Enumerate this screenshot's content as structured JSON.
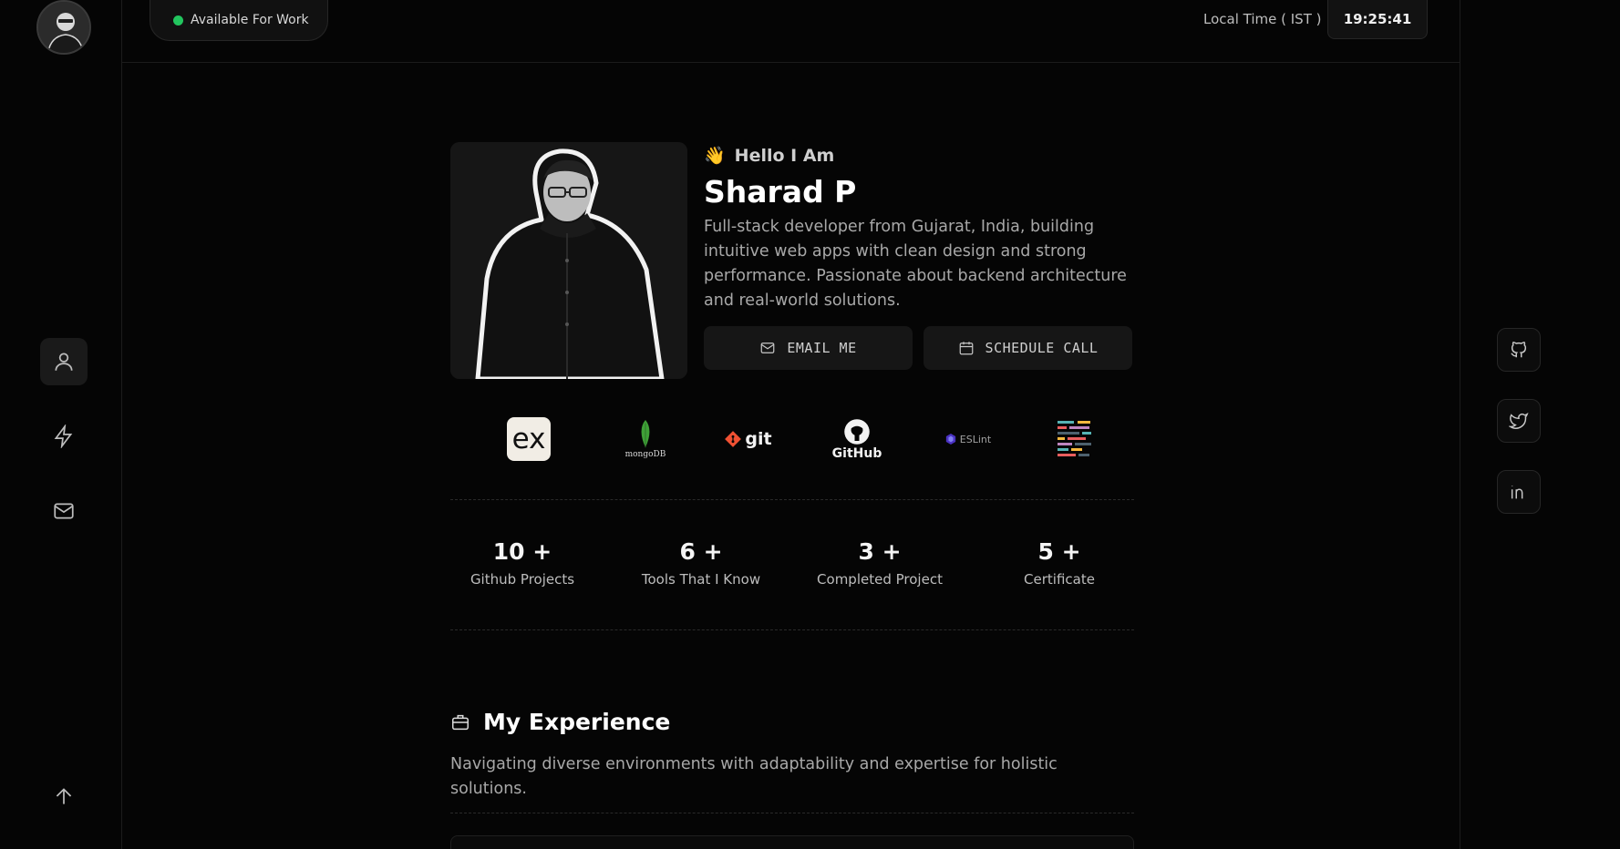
{
  "status": {
    "label": "Available For Work",
    "color": "#22c55e"
  },
  "clock": {
    "label": "Local Time ( IST )",
    "value": "19:25:41"
  },
  "sidebar": {
    "items": [
      {
        "icon": "user-icon"
      },
      {
        "icon": "lightning-icon"
      },
      {
        "icon": "mail-icon"
      }
    ],
    "scroll_top_icon": "arrow-up-icon"
  },
  "socials": [
    {
      "icon": "github-icon"
    },
    {
      "icon": "twitter-icon"
    },
    {
      "icon": "linkedin-icon"
    }
  ],
  "hero": {
    "greeting_emoji": "👋",
    "greeting": "Hello I Am",
    "name": "Sharad P",
    "bio": "Full-stack developer from Gujarat, India, building intuitive web apps with clean design and strong performance. Passionate about backend architecture and real-world solutions.",
    "email_label": "EMAIL ME",
    "schedule_label": "SCHEDULE CALL"
  },
  "tools": [
    {
      "name": "express-logo",
      "text": "ex"
    },
    {
      "name": "mongodb-logo",
      "text": "mongoDB"
    },
    {
      "name": "git-logo",
      "text": "git"
    },
    {
      "name": "github-logo",
      "text": "GitHub"
    },
    {
      "name": "eslint-logo",
      "text": "ESLint"
    },
    {
      "name": "prettier-logo",
      "text": ""
    }
  ],
  "stats": [
    {
      "value": "10 +",
      "label": "Github Projects"
    },
    {
      "value": "6 +",
      "label": "Tools That I Know"
    },
    {
      "value": "3 +",
      "label": "Completed Project"
    },
    {
      "value": "5 +",
      "label": "Certificate"
    }
  ],
  "experience": {
    "title": "My Experience",
    "subtitle": "Navigating diverse environments with adaptability and expertise for holistic solutions."
  }
}
